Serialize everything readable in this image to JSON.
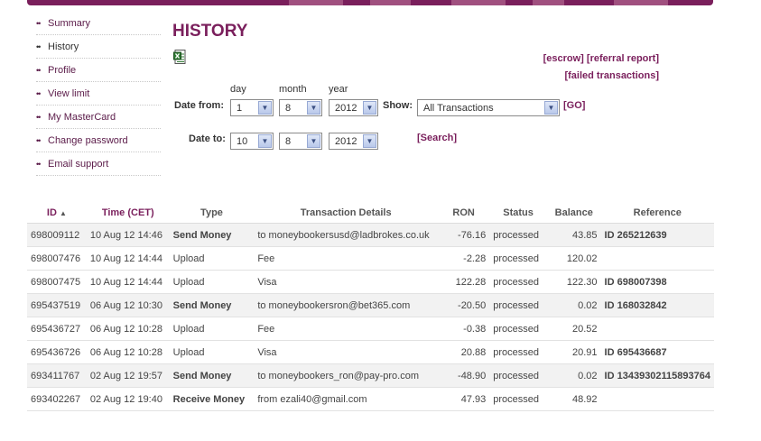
{
  "sidebar": {
    "items": [
      {
        "label": "Summary"
      },
      {
        "label": "History"
      },
      {
        "label": "Profile"
      },
      {
        "label": "View limit"
      },
      {
        "label": "My MasterCard"
      },
      {
        "label": "Change password"
      },
      {
        "label": "Email support"
      }
    ],
    "active": "History",
    "bullet": "••"
  },
  "page": {
    "title": "HISTORY",
    "links": {
      "escrow": "[escrow]",
      "referral_report": "[referral report]",
      "failed_transactions": "[failed transactions]"
    }
  },
  "filter": {
    "day_label": "day",
    "month_label": "month",
    "year_label": "year",
    "date_from_label": "Date from:",
    "date_to_label": "Date to:",
    "show_label": "Show:",
    "from": {
      "day": "1",
      "month": "8",
      "year": "2012"
    },
    "to": {
      "day": "10",
      "month": "8",
      "year": "2012"
    },
    "show_value": "All Transactions",
    "go_label": "[GO]",
    "search_label": "[Search]"
  },
  "table": {
    "headers": {
      "id": "ID",
      "time": "Time (CET)",
      "type": "Type",
      "details": "Transaction Details",
      "ron": "RON",
      "status": "Status",
      "balance": "Balance",
      "reference": "Reference"
    },
    "rows": [
      {
        "id": "698009112",
        "time": "10 Aug 12 14:46",
        "type": "Send Money",
        "details": "to moneybookersusd@ladbrokes.co.uk",
        "ron": "-76.16",
        "status": "processed",
        "balance": "43.85",
        "reference": "ID 265212639"
      },
      {
        "id": "698007476",
        "time": "10 Aug 12 14:44",
        "type": "Upload",
        "details": "Fee",
        "ron": "-2.28",
        "status": "processed",
        "balance": "120.02",
        "reference": ""
      },
      {
        "id": "698007475",
        "time": "10 Aug 12 14:44",
        "type": "Upload",
        "details": "Visa",
        "ron": "122.28",
        "status": "processed",
        "balance": "122.30",
        "reference": "ID 698007398"
      },
      {
        "id": "695437519",
        "time": "06 Aug 12 10:30",
        "type": "Send Money",
        "details": "to moneybookersron@bet365.com",
        "ron": "-20.50",
        "status": "processed",
        "balance": "0.02",
        "reference": "ID 168032842"
      },
      {
        "id": "695436727",
        "time": "06 Aug 12 10:28",
        "type": "Upload",
        "details": "Fee",
        "ron": "-0.38",
        "status": "processed",
        "balance": "20.52",
        "reference": ""
      },
      {
        "id": "695436726",
        "time": "06 Aug 12 10:28",
        "type": "Upload",
        "details": "Visa",
        "ron": "20.88",
        "status": "processed",
        "balance": "20.91",
        "reference": "ID 695436687"
      },
      {
        "id": "693411767",
        "time": "02 Aug 12 19:57",
        "type": "Send Money",
        "details": "to moneybookers_ron@pay-pro.com",
        "ron": "-48.90",
        "status": "processed",
        "balance": "0.02",
        "reference": "ID 13439302115893764"
      },
      {
        "id": "693402267",
        "time": "02 Aug 12 19:40",
        "type": "Receive Money",
        "details": "from ezali40@gmail.com",
        "ron": "47.93",
        "status": "processed",
        "balance": "48.92",
        "reference": ""
      }
    ]
  },
  "icons": {
    "excel": "excel-export-icon",
    "dropdown": "chevron-down-icon",
    "sort": "sort-ascending-icon"
  },
  "colors": {
    "brand": "#7a1f5c",
    "row_shade": "#f2f2f2"
  }
}
